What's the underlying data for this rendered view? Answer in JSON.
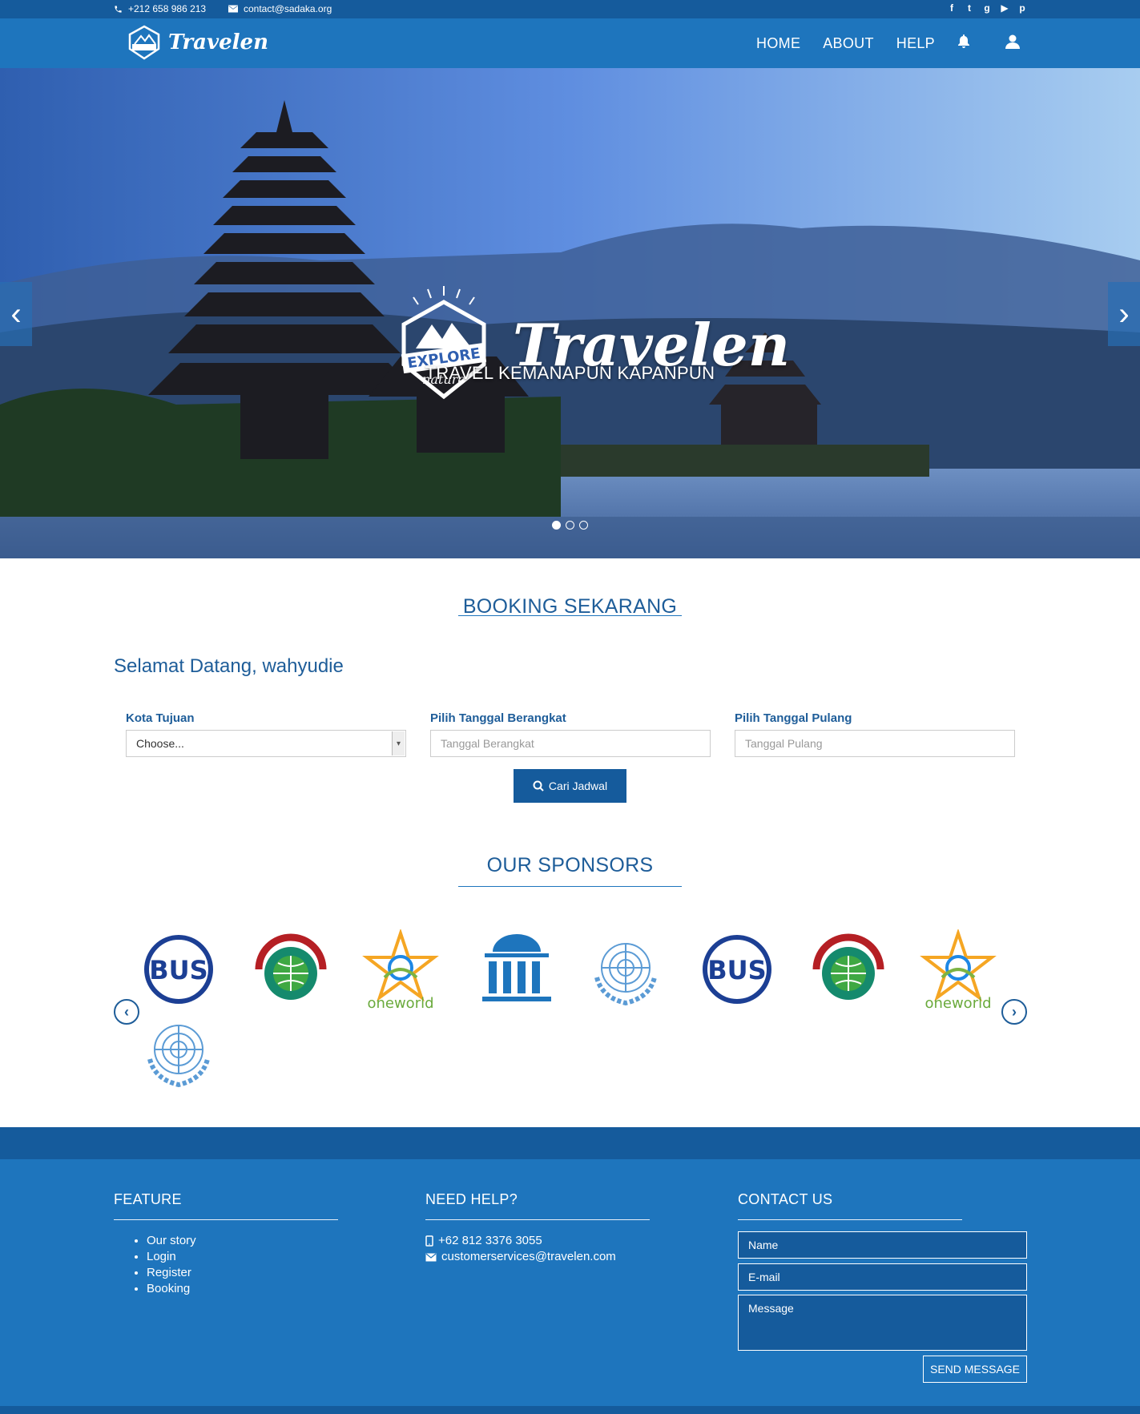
{
  "topbar": {
    "phone": "+212 658 986 213",
    "email": "contact@sadaka.org",
    "social": [
      "facebook-icon",
      "twitter-icon",
      "google-plus-icon",
      "youtube-icon",
      "pinterest-icon"
    ]
  },
  "brand": {
    "logo_badge_top": "EXPLORE",
    "logo_badge_bottom": "nature",
    "name": "Travelen"
  },
  "nav": {
    "home": "HOME",
    "about": "ABOUT",
    "help": "HELP"
  },
  "hero": {
    "tagline": "TRAVEL KEMANAPUN KAPANPUN",
    "slides": 3,
    "active_slide": 1
  },
  "booking": {
    "title": "BOOKING SEKARANG",
    "welcome": "Selamat Datang, wahyudie",
    "kota_label": "Kota Tujuan",
    "kota_value": "Choose...",
    "berangkat_label": "Pilih Tanggal Berangkat",
    "berangkat_placeholder": "Tanggal Berangkat",
    "pulang_label": "Pilih Tanggal Pulang",
    "pulang_placeholder": "Tanggal Pulang",
    "search_button": "Cari Jadwal"
  },
  "sponsors": {
    "title": "OUR SPONSORS",
    "logos": [
      "bus-logo",
      "wikimedia-logo",
      "oneworld-logo",
      "parliament-logo",
      "un-logo",
      "bus-logo",
      "wikimedia-logo",
      "oneworld-logo",
      "un-logo"
    ],
    "bus_text": "BUS",
    "oneworld_text": "oneworld"
  },
  "footer": {
    "feature_title": "FEATURE",
    "feature_items": [
      "Our story",
      "Login",
      "Register",
      "Booking"
    ],
    "help_title": "NEED HELP?",
    "help_phone": "+62 812 3376 3055",
    "help_email": "customerservices@travelen.com",
    "contact_title": "CONTACT US",
    "name_placeholder": "Name",
    "email_placeholder": "E-mail",
    "message_placeholder": "Message",
    "send_button": "SEND MESSAGE"
  },
  "colors": {
    "primary": "#1e75bd",
    "dark": "#155b9c",
    "heading": "#1e5d99"
  }
}
